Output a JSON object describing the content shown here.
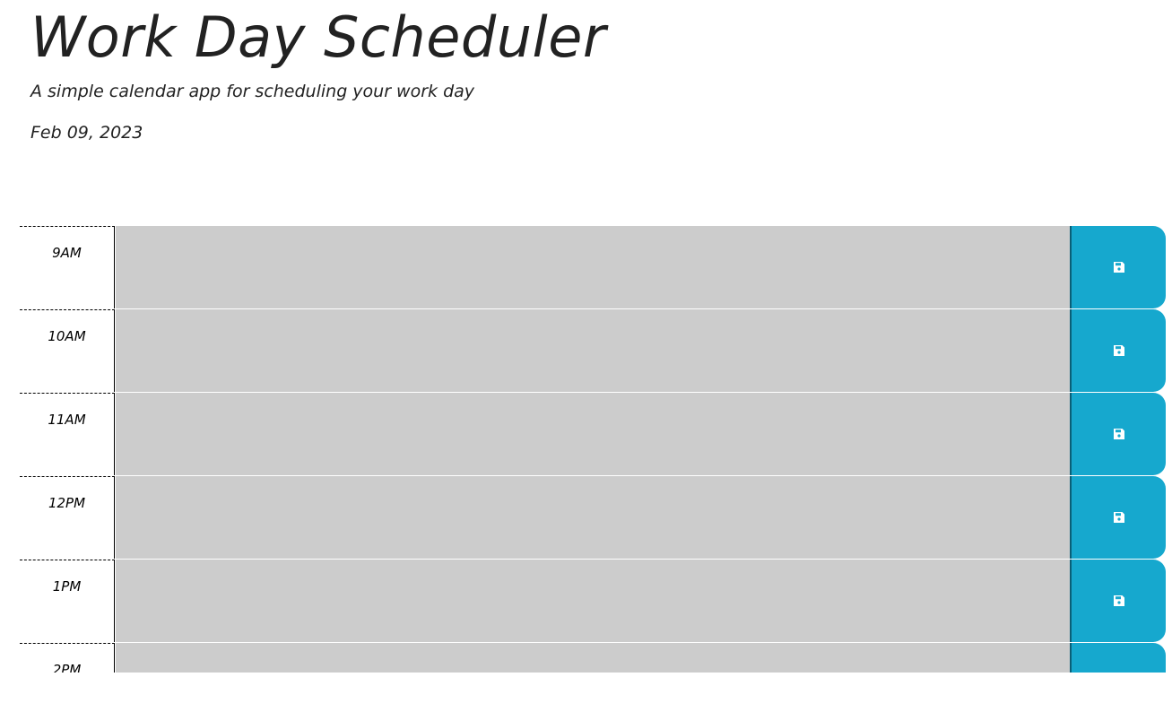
{
  "header": {
    "title": "Work Day Scheduler",
    "subtitle": "A simple calendar app for scheduling your work day",
    "date": "Feb 09, 2023"
  },
  "colors": {
    "past": "#cccccc",
    "save_button": "#16a8ce"
  },
  "time_blocks": [
    {
      "hour": "9AM",
      "text": "",
      "save_icon": "save-icon"
    },
    {
      "hour": "10AM",
      "text": "",
      "save_icon": "save-icon"
    },
    {
      "hour": "11AM",
      "text": "",
      "save_icon": "save-icon"
    },
    {
      "hour": "12PM",
      "text": "",
      "save_icon": "save-icon"
    },
    {
      "hour": "1PM",
      "text": "",
      "save_icon": "save-icon"
    },
    {
      "hour": "2PM",
      "text": "",
      "save_icon": "save-icon"
    }
  ]
}
